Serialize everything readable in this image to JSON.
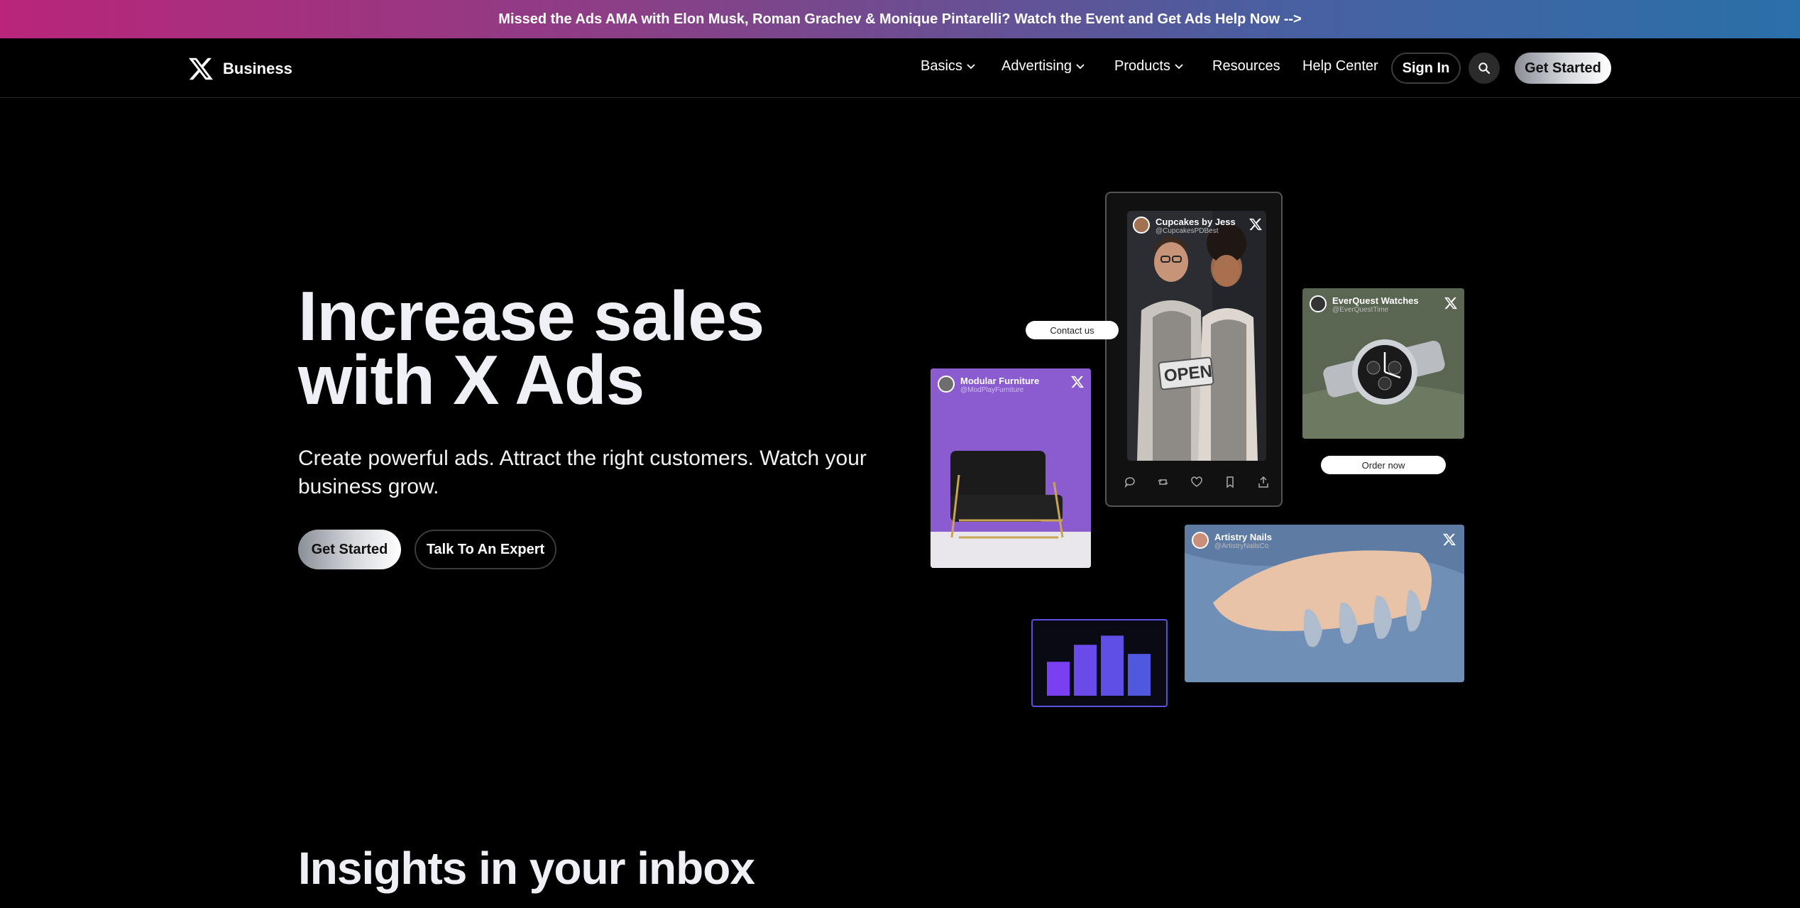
{
  "banner": {
    "text": "Missed the Ads AMA with Elon Musk, Roman Grachev & Monique Pintarelli? Watch the Event and Get Ads Help Now -->"
  },
  "header": {
    "brand": "Business",
    "nav": [
      {
        "label": "Basics",
        "dropdown": true
      },
      {
        "label": "Advertising",
        "dropdown": true
      },
      {
        "label": "Products",
        "dropdown": true
      },
      {
        "label": "Resources",
        "dropdown": false
      },
      {
        "label": "Help Center",
        "dropdown": false
      }
    ],
    "sign_in": "Sign In",
    "get_started": "Get Started"
  },
  "hero": {
    "title_line1": "Increase sales",
    "title_line2": "with X Ads",
    "subtitle": "Create powerful ads. Attract the right customers. Watch your business grow.",
    "primary_cta": "Get Started",
    "secondary_cta": "Talk To An Expert"
  },
  "collage": {
    "phone_card": {
      "name": "Cupcakes by Jess",
      "handle": "@CupcakesPDBest",
      "sign_text": "OPEN"
    },
    "contact_pill": "Contact us",
    "furniture_card": {
      "name": "Modular Furniture",
      "handle": "@ModPlayFurniture"
    },
    "watch_card": {
      "name": "EverQuest Watches",
      "handle": "@EverQuestTime"
    },
    "order_pill": "Order now",
    "nails_card": {
      "name": "Artistry Nails",
      "handle": "@ArtistryNailsCo"
    },
    "bars": [
      0.52,
      0.78,
      0.92,
      0.64
    ]
  },
  "insights": {
    "heading": "Insights in your inbox"
  },
  "colors": {
    "banner_start": "#b9257a",
    "banner_end": "#2a70a8",
    "chart_bar": "#6a3ff0",
    "chart_border": "#5b4fe0"
  }
}
